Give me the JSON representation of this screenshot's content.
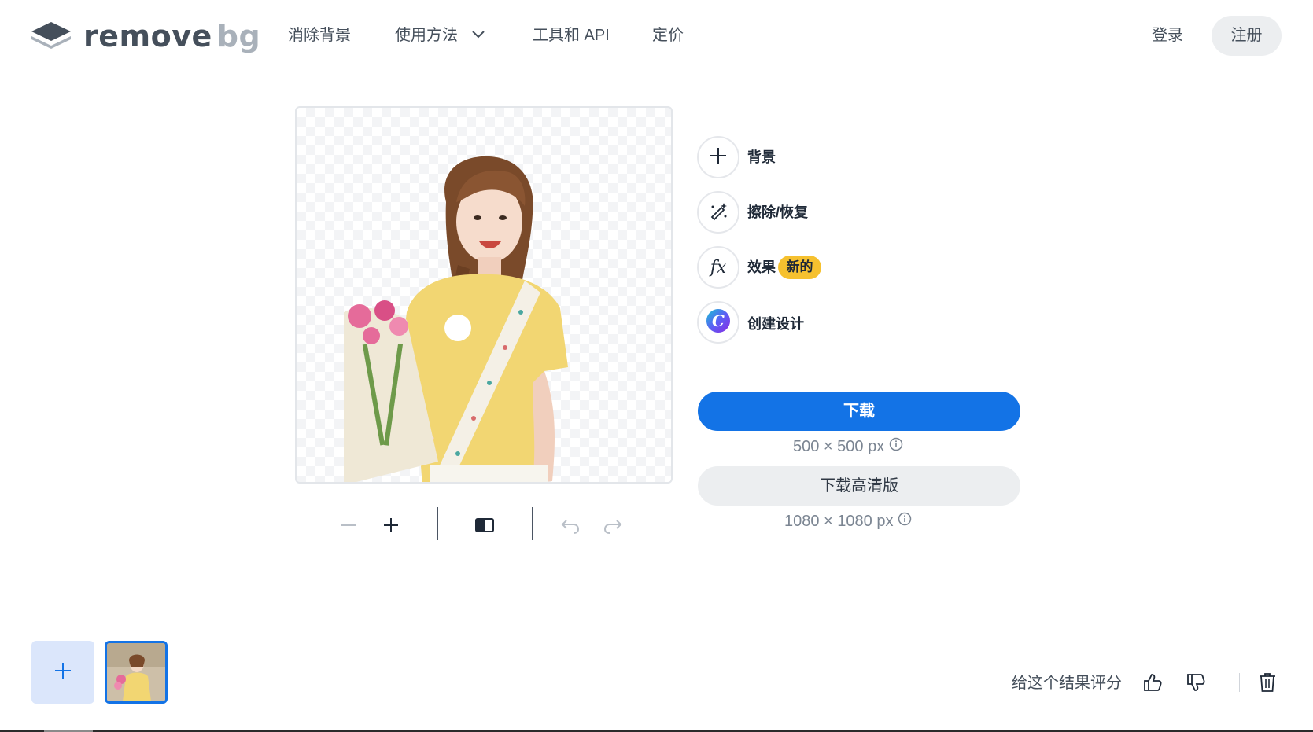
{
  "header": {
    "logo": {
      "part1": "remove",
      "part2": "bg"
    },
    "nav": {
      "remove_bg": "消除背景",
      "how_to": "使用方法",
      "tools_api": "工具和 API",
      "pricing": "定价"
    },
    "login": "登录",
    "signup": "注册"
  },
  "actions": {
    "background": "背景",
    "erase_restore": "擦除/恢复",
    "effects": "效果",
    "new_badge": "新的",
    "create_design": "创建设计"
  },
  "download": {
    "label": "下载",
    "size": "500 × 500 px",
    "hd_label": "下载高清版",
    "hd_size": "1080 × 1080 px"
  },
  "footer": {
    "rate_label": "给这个结果评分"
  },
  "colors": {
    "primary": "#1373e6",
    "badge": "#f6c12f"
  },
  "icons": {
    "zoom_out": "minus-icon",
    "zoom_in": "plus-icon",
    "compare": "compare-icon",
    "undo": "undo-icon",
    "redo": "redo-icon",
    "thumbs_up": "thumbs-up-icon",
    "thumbs_down": "thumbs-down-icon",
    "delete": "trash-icon"
  }
}
